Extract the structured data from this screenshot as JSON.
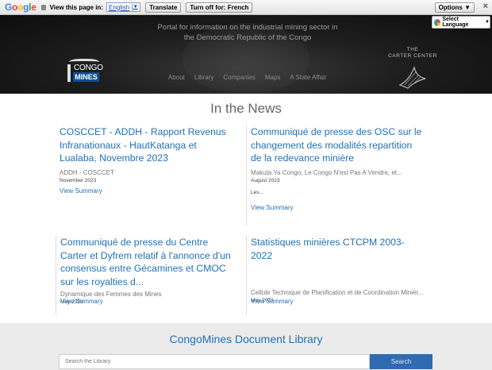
{
  "translate_bar": {
    "logo": "Google",
    "view_text": "View this page in:",
    "language": "English",
    "translate_button": "Translate",
    "turn_off_button": "Turn off for: French",
    "options_button": "Options ▼",
    "close": "×"
  },
  "select_language": "Select Language",
  "header": {
    "tagline_line1": "Portal for information on the industrial mining sector in",
    "tagline_line2": "the Democratic Republic of the Congo",
    "logo_top": "CONGO",
    "logo_bottom": "MINES",
    "partner_line1": "THE",
    "partner_line2": "CARTER CENTER",
    "nav": [
      "About",
      "Library",
      "Companies",
      "Maps",
      "A State Affair"
    ]
  },
  "news": {
    "title": "In the News",
    "items": [
      {
        "title": "COSCCET - ADDH - Rapport Revenus Infranationaux - HautKatanga et Lualaba, Novembre 2023",
        "author": "ADDH - COSCCET",
        "date": "November 2023",
        "excerpt": "",
        "link": "View Summary"
      },
      {
        "title": "Communiqué de presse des OSC sur le changement des modalités repartition de la redevance minière",
        "author": "Makuta Ya Congo, Le Congo N'est Pas A Vendre, et...",
        "date": "August 2023",
        "excerpt": "Les...",
        "link": "View Summary"
      },
      {
        "title": "Communiqué de presse du Centre Carter et Dyfrem relatif à l'annonce d'un consensus entre Gécamines et CMOC sur les royalties d...",
        "author": "Dynamique des Femmes des Mines",
        "date": "May 2023",
        "excerpt": "",
        "link": "View Summary"
      },
      {
        "title": "Statistiques minières CTCPM 2003-2022",
        "author": "Cellule Technique de Planification et de Coordination Minièr...",
        "date": "May 2023",
        "excerpt": "",
        "link": "View Summary"
      }
    ]
  },
  "library": {
    "title": "CongoMines Document Library",
    "search_placeholder": "Search the Library",
    "search_button": "Search"
  },
  "colors": {
    "link_blue": "#2071b9",
    "search_button": "#2f6bb3",
    "hero_bg": "#1a1a1a"
  }
}
